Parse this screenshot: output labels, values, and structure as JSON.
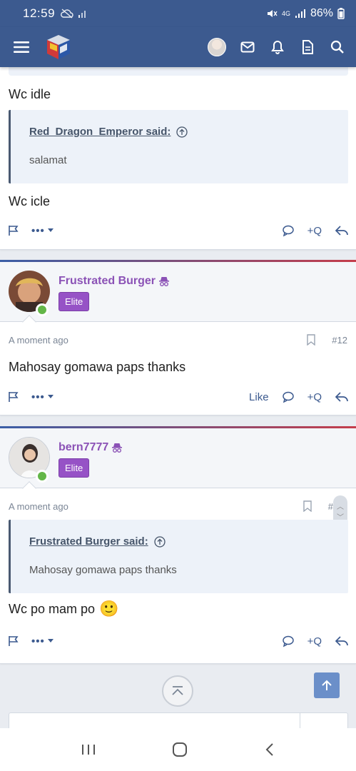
{
  "status_bar": {
    "time": "12:59",
    "battery": "86%",
    "network": "4G"
  },
  "app_bar": {
    "icons": [
      "menu-icon",
      "site-logo",
      "user-avatar",
      "mail-icon",
      "bell-icon",
      "document-icon",
      "search-icon"
    ]
  },
  "posts": [
    {
      "text_before": "Wc idle",
      "quote": {
        "author_said": "Red_Dragon_Emperor said:",
        "body": "salamat"
      },
      "text_after": "Wc icle",
      "actions": {
        "quote_label": "+Q"
      }
    },
    {
      "username": "Frustrated Burger",
      "badge": "Elite",
      "time": "A moment ago",
      "number": "#12",
      "text": "Mahosay gomawa paps thanks",
      "actions": {
        "like_label": "Like",
        "quote_label": "+Q"
      }
    },
    {
      "username": "bern7777",
      "badge": "Elite",
      "time": "A moment ago",
      "number": "#",
      "quote": {
        "author_said": "Frustrated Burger said:",
        "body": "Mahosay gomawa paps thanks"
      },
      "text": "Wc po mam po",
      "emoji": "🙂",
      "actions": {
        "quote_label": "+Q"
      }
    }
  ],
  "colors": {
    "header": "#3c5a8f",
    "username": "#8b52b6",
    "badge": "#9652c6",
    "accent": "#6b8fc9"
  }
}
